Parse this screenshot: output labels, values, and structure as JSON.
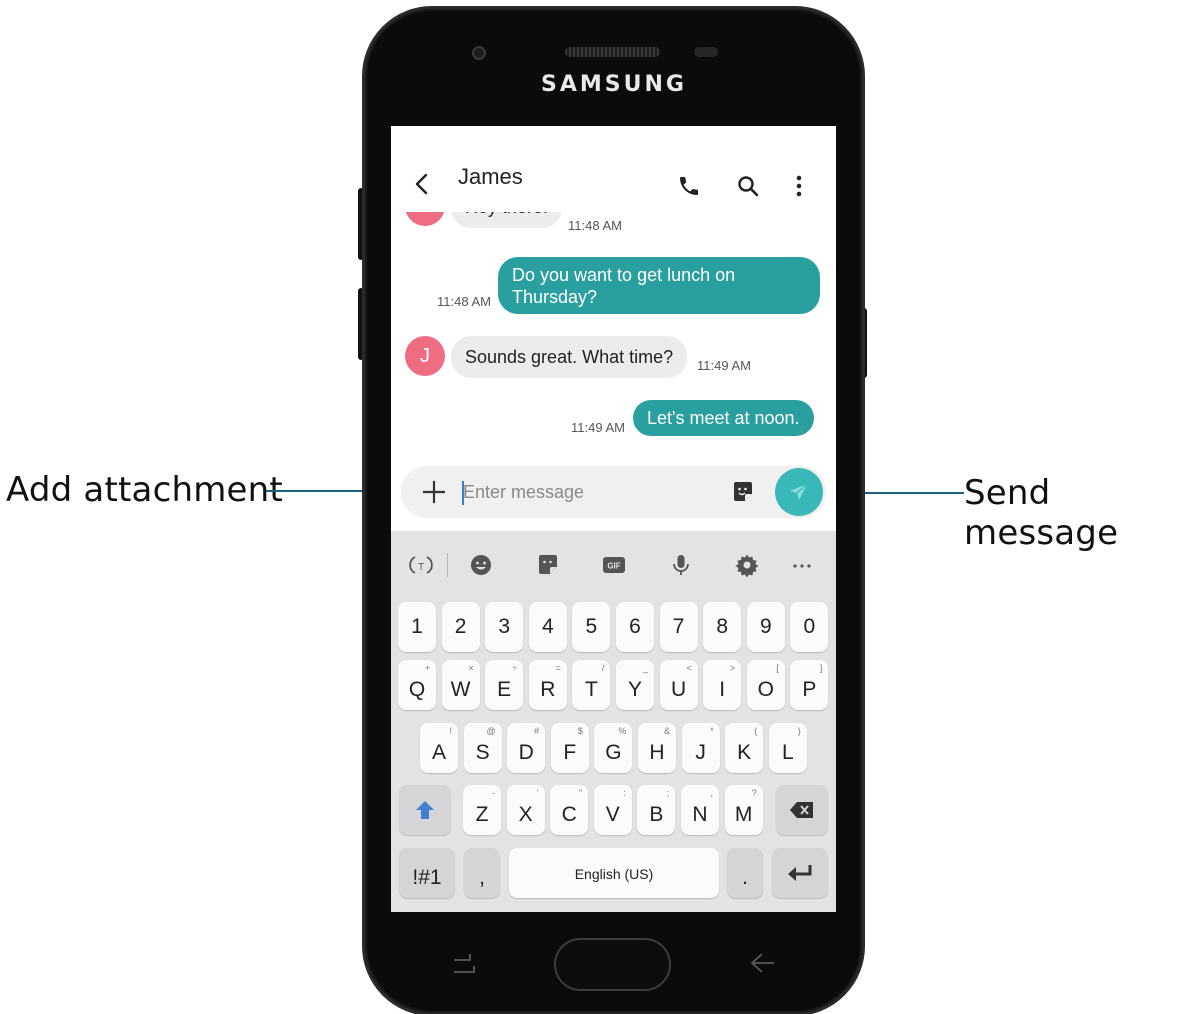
{
  "callouts": {
    "left": "Add attachment",
    "right": "Send message"
  },
  "device": {
    "brand": "SAMSUNG"
  },
  "header": {
    "contact_name": "James",
    "back_icon": "chevron-left-icon",
    "call_icon": "phone-icon",
    "search_icon": "search-icon",
    "more_icon": "more-vertical-icon"
  },
  "messages": [
    {
      "direction": "incoming",
      "text": "Hey there!",
      "time": "11:48 AM",
      "avatar": ""
    },
    {
      "direction": "outgoing",
      "text": "Do you want to get lunch on Thursday?",
      "line1": "Do you want to get lunch on",
      "line2": "Thursday?",
      "time": "11:48 AM"
    },
    {
      "direction": "incoming",
      "text": "Sounds great. What time?",
      "time": "11:49 AM",
      "avatar": "J"
    },
    {
      "direction": "outgoing",
      "text": "Let's meet at noon.",
      "time": "11:49 AM"
    }
  ],
  "composer": {
    "placeholder": "Enter message",
    "value": "",
    "attach_icon": "plus-icon",
    "sticker_icon": "sticker-icon",
    "send_icon": "send-icon"
  },
  "keyboard": {
    "toolbar": [
      "translate-icon",
      "emoji-icon",
      "sticker-icon",
      "gif-icon",
      "mic-icon",
      "settings-icon",
      "more-horizontal-icon"
    ],
    "gif_label": "GIF",
    "number_row": [
      "1",
      "2",
      "3",
      "4",
      "5",
      "6",
      "7",
      "8",
      "9",
      "0"
    ],
    "row1": [
      {
        "k": "Q",
        "s": "+"
      },
      {
        "k": "W",
        "s": "×"
      },
      {
        "k": "E",
        "s": "÷"
      },
      {
        "k": "R",
        "s": "="
      },
      {
        "k": "T",
        "s": "/"
      },
      {
        "k": "Y",
        "s": "_"
      },
      {
        "k": "U",
        "s": "<"
      },
      {
        "k": "I",
        "s": ">"
      },
      {
        "k": "O",
        "s": "["
      },
      {
        "k": "P",
        "s": "]"
      }
    ],
    "row2": [
      {
        "k": "A",
        "s": "!"
      },
      {
        "k": "S",
        "s": "@"
      },
      {
        "k": "D",
        "s": "#"
      },
      {
        "k": "F",
        "s": "$"
      },
      {
        "k": "G",
        "s": "%"
      },
      {
        "k": "H",
        "s": "&"
      },
      {
        "k": "J",
        "s": "*"
      },
      {
        "k": "K",
        "s": "("
      },
      {
        "k": "L",
        "s": ")"
      }
    ],
    "row3": [
      {
        "k": "Z",
        "s": "-"
      },
      {
        "k": "X",
        "s": "'"
      },
      {
        "k": "C",
        "s": "\""
      },
      {
        "k": "V",
        "s": ":"
      },
      {
        "k": "B",
        "s": ";"
      },
      {
        "k": "N",
        "s": ","
      },
      {
        "k": "M",
        "s": "?"
      }
    ],
    "shift_icon": "shift-arrow-icon",
    "backspace_icon": "backspace-icon",
    "symbols_label": "!#1",
    "comma_label": ",",
    "space_label": "English (US)",
    "period_label": ".",
    "enter_icon": "enter-icon"
  },
  "nav": {
    "recent_icon": "recent-apps-icon",
    "home_icon": "home-button",
    "back_icon": "back-arrow-icon"
  },
  "colors": {
    "accent": "#2a9fa0",
    "send": "#39b8b9",
    "avatar": "#ef6d82",
    "callout_line": "#1a5f86"
  }
}
